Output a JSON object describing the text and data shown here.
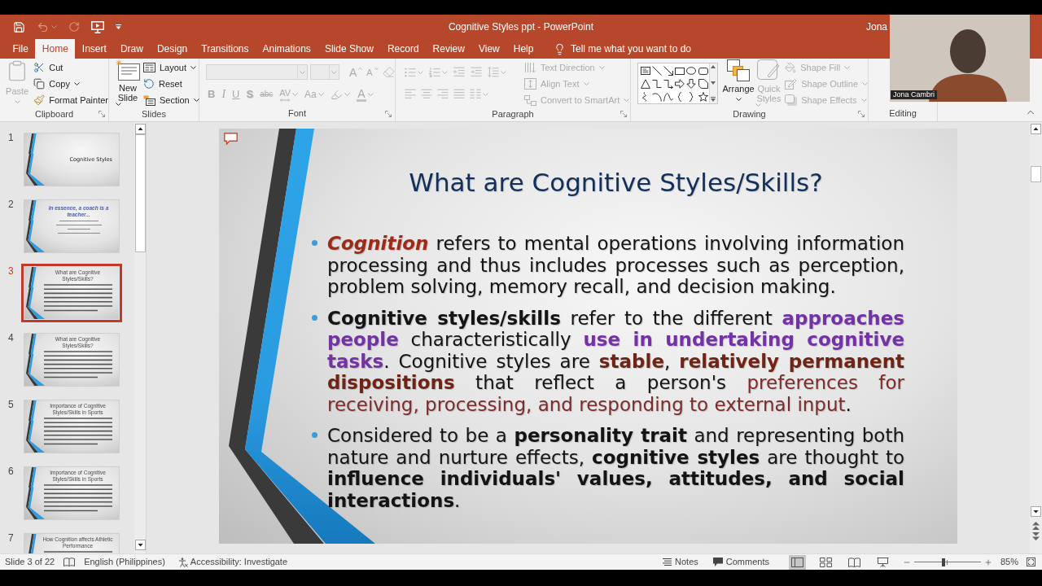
{
  "window": {
    "title": "Cognitive Styles ppt - PowerPoint",
    "user": "Jona"
  },
  "quick_access": [
    {
      "kind": "save",
      "disabled": false
    },
    {
      "kind": "undo",
      "disabled": true
    },
    {
      "kind": "redo",
      "disabled": true
    },
    {
      "kind": "present",
      "disabled": false
    },
    {
      "kind": "customize",
      "disabled": false
    }
  ],
  "tabs": [
    {
      "label": "File",
      "selected": false
    },
    {
      "label": "Home",
      "selected": true
    },
    {
      "label": "Insert",
      "selected": false
    },
    {
      "label": "Draw",
      "selected": false
    },
    {
      "label": "Design",
      "selected": false
    },
    {
      "label": "Transitions",
      "selected": false
    },
    {
      "label": "Animations",
      "selected": false
    },
    {
      "label": "Slide Show",
      "selected": false
    },
    {
      "label": "Record",
      "selected": false
    },
    {
      "label": "Review",
      "selected": false
    },
    {
      "label": "View",
      "selected": false
    },
    {
      "label": "Help",
      "selected": false
    }
  ],
  "tell_me": {
    "placeholder": "Tell me what you want to do"
  },
  "ribbon": {
    "clipboard": {
      "label": "Clipboard",
      "paste": {
        "label": "Paste",
        "disabled": true
      },
      "tools": [
        {
          "kind": "cut",
          "label": "Cut",
          "disabled": false,
          "menu": false
        },
        {
          "kind": "copy",
          "label": "Copy",
          "disabled": false,
          "menu": true
        },
        {
          "kind": "painter",
          "label": "Format Painter",
          "disabled": false,
          "menu": false
        }
      ]
    },
    "slides": {
      "label": "Slides",
      "new_slide": {
        "label": "New Slide",
        "disabled": false
      },
      "tools": [
        {
          "kind": "layout",
          "label": "Layout",
          "disabled": false,
          "menu": true
        },
        {
          "kind": "reset",
          "label": "Reset",
          "disabled": false,
          "menu": false
        },
        {
          "kind": "section",
          "label": "Section",
          "disabled": false,
          "menu": true
        }
      ]
    },
    "font": {
      "label": "Font",
      "fields": [
        {
          "kind": "name",
          "disabled": true
        },
        {
          "kind": "size",
          "disabled": true
        }
      ],
      "sizing": [
        {
          "kind": "grow",
          "glyph": "A",
          "disabled": true
        },
        {
          "kind": "shrink",
          "glyph": "A",
          "disabled": true
        },
        {
          "kind": "clear",
          "disabled": true
        }
      ],
      "styles": [
        {
          "kind": "bold",
          "glyph": "B",
          "disabled": true,
          "menu": false
        },
        {
          "kind": "italic",
          "glyph": "I",
          "disabled": true,
          "menu": false
        },
        {
          "kind": "underline",
          "glyph": "U",
          "disabled": true,
          "menu": false
        },
        {
          "kind": "shadow",
          "glyph": "S",
          "disabled": true,
          "menu": false
        },
        {
          "kind": "strike",
          "glyph": "abc",
          "disabled": true,
          "menu": false
        },
        {
          "kind": "spacing",
          "glyph": "AV",
          "disabled": true,
          "menu": true
        },
        {
          "kind": "case",
          "glyph": "Aa",
          "disabled": true,
          "menu": true
        },
        {
          "kind": "highlight",
          "disabled": true,
          "menu": true
        },
        {
          "kind": "color",
          "glyph": "A",
          "disabled": true,
          "menu": true
        }
      ]
    },
    "paragraph": {
      "label": "Paragraph",
      "lists": [
        {
          "kind": "bullets",
          "disabled": true,
          "menu": true
        },
        {
          "kind": "numbering",
          "disabled": true,
          "menu": true
        },
        {
          "kind": "outdent",
          "disabled": true,
          "menu": false
        },
        {
          "kind": "indent",
          "disabled": true,
          "menu": false
        },
        {
          "kind": "spacing",
          "disabled": true,
          "menu": true
        }
      ],
      "alignment": [
        {
          "kind": "left",
          "disabled": true,
          "menu": false
        },
        {
          "kind": "center",
          "disabled": true,
          "menu": false
        },
        {
          "kind": "right",
          "disabled": true,
          "menu": false
        },
        {
          "kind": "justify",
          "disabled": true,
          "menu": false
        },
        {
          "kind": "columns",
          "disabled": true,
          "menu": true
        }
      ],
      "tools": [
        {
          "kind": "direction",
          "label": "Text Direction",
          "disabled": true,
          "menu": true
        },
        {
          "kind": "align",
          "label": "Align Text",
          "disabled": true,
          "menu": true
        },
        {
          "kind": "smartart",
          "label": "Convert to SmartArt",
          "disabled": true,
          "menu": true
        }
      ]
    },
    "drawing": {
      "label": "Drawing",
      "arrange": {
        "label": "Arrange",
        "disabled": false
      },
      "quick_styles": {
        "label": "Quick Styles",
        "disabled": true
      },
      "tools": [
        {
          "kind": "fill",
          "label": "Shape Fill",
          "disabled": true,
          "menu": true
        },
        {
          "kind": "outline",
          "label": "Shape Outline",
          "disabled": true,
          "menu": true
        },
        {
          "kind": "effects",
          "label": "Shape Effects",
          "disabled": true,
          "menu": true
        }
      ]
    },
    "editing": {
      "label": "Editing"
    }
  },
  "slides": [
    {
      "number": "1",
      "kind": "title",
      "title": "Cognitive Styles",
      "selected": false
    },
    {
      "number": "2",
      "kind": "statement",
      "title": "In essence, a coach is a teacher...",
      "selected": false
    },
    {
      "number": "3",
      "kind": "content",
      "title": "What are Cognitive Styles/Skills?",
      "selected": true
    },
    {
      "number": "4",
      "kind": "content",
      "title": "What are Cognitive Styles/Skills?",
      "selected": false
    },
    {
      "number": "5",
      "kind": "content",
      "title": "Importance of Cognitive Styles/Skills in Sports",
      "selected": false
    },
    {
      "number": "6",
      "kind": "content",
      "title": "Importance of Cognitive Styles/Skills in Sports",
      "selected": false
    },
    {
      "number": "7",
      "kind": "content",
      "title": "How Cognition affects Athletic Performance",
      "selected": false
    }
  ],
  "slide": {
    "title": "What are Cognitive Styles/Skills?",
    "bullets": [
      {
        "runs": [
          {
            "text": "Cognition",
            "kind": "term"
          },
          {
            "text": " refers to mental operations involving information processing and thus includes processes such as perception, problem solving, memory recall, and decision making.",
            "kind": "plain"
          }
        ]
      },
      {
        "runs": [
          {
            "text": "Cognitive styles/skills",
            "kind": "bold"
          },
          {
            "text": " refer to the different ",
            "kind": "plain"
          },
          {
            "text": "approaches people",
            "kind": "purple"
          },
          {
            "text": " characteristically ",
            "kind": "plain"
          },
          {
            "text": "use in undertaking cognitive tasks",
            "kind": "purple"
          },
          {
            "text": ". Cognitive styles are ",
            "kind": "plain"
          },
          {
            "text": "stable",
            "kind": "maroon"
          },
          {
            "text": ", ",
            "kind": "plain"
          },
          {
            "text": "relatively permanent dispositions",
            "kind": "maroon"
          },
          {
            "text": " that reflect a person's ",
            "kind": "plain"
          },
          {
            "text": "preferences for receiving, processing, and responding to external input",
            "kind": "tint"
          },
          {
            "text": ".",
            "kind": "plain"
          }
        ]
      },
      {
        "runs": [
          {
            "text": "Considered to be a ",
            "kind": "plain"
          },
          {
            "text": "personality trait",
            "kind": "bold"
          },
          {
            "text": " and representing both nature and nurture effects, ",
            "kind": "plain"
          },
          {
            "text": "cognitive styles",
            "kind": "bold"
          },
          {
            "text": " are thought to ",
            "kind": "plain"
          },
          {
            "text": "influence individuals' values, attitudes, and social interactions",
            "kind": "bold"
          },
          {
            "text": ".",
            "kind": "plain"
          }
        ]
      }
    ]
  },
  "status_bar": {
    "slide_info": "Slide 3 of 22",
    "language": "English (Philippines)",
    "accessibility": "Accessibility: Investigate",
    "notes": "Notes",
    "comments": "Comments",
    "views": [
      {
        "kind": "normal",
        "selected": true
      },
      {
        "kind": "sorter",
        "selected": false
      },
      {
        "kind": "reading",
        "selected": false
      },
      {
        "kind": "show",
        "selected": false
      }
    ],
    "zoom": {
      "level": 0.44,
      "reading": "85%"
    }
  },
  "webcam": {
    "name": "Jona Cambri"
  }
}
